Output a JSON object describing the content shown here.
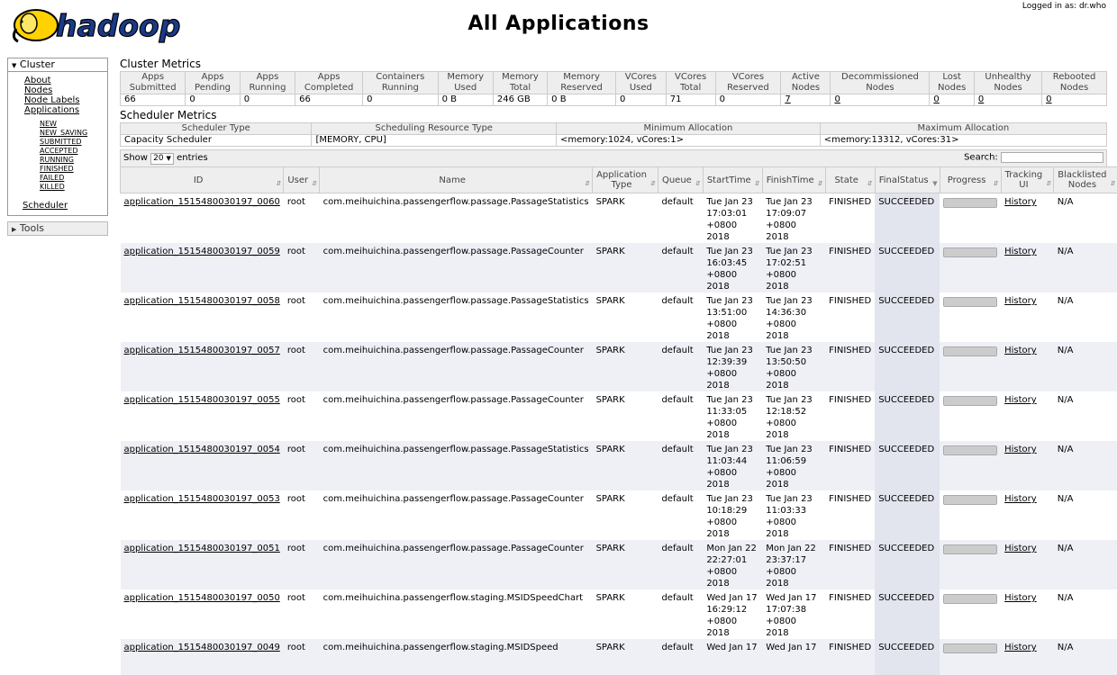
{
  "header": {
    "logo_text": "hadoop",
    "title": "All Applications",
    "login": "Logged in as: dr.who"
  },
  "sidebar": {
    "cluster_label": "Cluster",
    "cluster_items": [
      "About",
      "Node Labels",
      "Applications"
    ],
    "nodes_label": "Nodes",
    "app_states": [
      "NEW",
      "NEW_SAVING",
      "SUBMITTED",
      "ACCEPTED",
      "RUNNING",
      "FINISHED",
      "FAILED",
      "KILLED"
    ],
    "scheduler_label": "Scheduler",
    "tools_label": "Tools"
  },
  "cluster_metrics": {
    "heading": "Cluster Metrics",
    "headers": [
      "Apps Submitted",
      "Apps Pending",
      "Apps Running",
      "Apps Completed",
      "Containers Running",
      "Memory Used",
      "Memory Total",
      "Memory Reserved",
      "VCores Used",
      "VCores Total",
      "VCores Reserved",
      "Active Nodes",
      "Decommissioned Nodes",
      "Lost Nodes",
      "Unhealthy Nodes",
      "Rebooted Nodes"
    ],
    "values": [
      "66",
      "0",
      "0",
      "66",
      "0",
      "0 B",
      "246 GB",
      "0 B",
      "0",
      "71",
      "0",
      "7",
      "0",
      "0",
      "0",
      "0"
    ]
  },
  "scheduler_metrics": {
    "heading": "Scheduler Metrics",
    "headers": [
      "Scheduler Type",
      "Scheduling Resource Type",
      "Minimum Allocation",
      "Maximum Allocation"
    ],
    "values": [
      "Capacity Scheduler",
      "[MEMORY, CPU]",
      "<memory:1024, vCores:1>",
      "<memory:13312, vCores:31>"
    ]
  },
  "table_controls": {
    "show_label": "Show",
    "page_size": "20",
    "entries_label": "entries",
    "search_label": "Search:"
  },
  "apps": {
    "headers": [
      "ID",
      "User",
      "Name",
      "Application Type",
      "Queue",
      "StartTime",
      "FinishTime",
      "State",
      "FinalStatus",
      "Progress",
      "Tracking UI",
      "Blacklisted Nodes"
    ],
    "rows": [
      {
        "id": "application_1515480030197_0060",
        "user": "root",
        "name": "com.meihuichina.passengerflow.passage.PassageStatistics",
        "type": "SPARK",
        "queue": "default",
        "start": "Tue Jan 23 17:03:01 +0800 2018",
        "finish": "Tue Jan 23 17:09:07 +0800 2018",
        "state": "FINISHED",
        "final": "SUCCEEDED",
        "progress": 1.0,
        "tracking": "History",
        "blacklisted": "N/A"
      },
      {
        "id": "application_1515480030197_0059",
        "user": "root",
        "name": "com.meihuichina.passengerflow.passage.PassageCounter",
        "type": "SPARK",
        "queue": "default",
        "start": "Tue Jan 23 16:03:45 +0800 2018",
        "finish": "Tue Jan 23 17:02:51 +0800 2018",
        "state": "FINISHED",
        "final": "SUCCEEDED",
        "progress": 1.0,
        "tracking": "History",
        "blacklisted": "N/A"
      },
      {
        "id": "application_1515480030197_0058",
        "user": "root",
        "name": "com.meihuichina.passengerflow.passage.PassageStatistics",
        "type": "SPARK",
        "queue": "default",
        "start": "Tue Jan 23 13:51:00 +0800 2018",
        "finish": "Tue Jan 23 14:36:30 +0800 2018",
        "state": "FINISHED",
        "final": "SUCCEEDED",
        "progress": 1.0,
        "tracking": "History",
        "blacklisted": "N/A"
      },
      {
        "id": "application_1515480030197_0057",
        "user": "root",
        "name": "com.meihuichina.passengerflow.passage.PassageCounter",
        "type": "SPARK",
        "queue": "default",
        "start": "Tue Jan 23 12:39:39 +0800 2018",
        "finish": "Tue Jan 23 13:50:50 +0800 2018",
        "state": "FINISHED",
        "final": "SUCCEEDED",
        "progress": 1.0,
        "tracking": "History",
        "blacklisted": "N/A"
      },
      {
        "id": "application_1515480030197_0055",
        "user": "root",
        "name": "com.meihuichina.passengerflow.passage.PassageCounter",
        "type": "SPARK",
        "queue": "default",
        "start": "Tue Jan 23 11:33:05 +0800 2018",
        "finish": "Tue Jan 23 12:18:52 +0800 2018",
        "state": "FINISHED",
        "final": "SUCCEEDED",
        "progress": 1.0,
        "tracking": "History",
        "blacklisted": "N/A"
      },
      {
        "id": "application_1515480030197_0054",
        "user": "root",
        "name": "com.meihuichina.passengerflow.passage.PassageStatistics",
        "type": "SPARK",
        "queue": "default",
        "start": "Tue Jan 23 11:03:44 +0800 2018",
        "finish": "Tue Jan 23 11:06:59 +0800 2018",
        "state": "FINISHED",
        "final": "SUCCEEDED",
        "progress": 1.0,
        "tracking": "History",
        "blacklisted": "N/A"
      },
      {
        "id": "application_1515480030197_0053",
        "user": "root",
        "name": "com.meihuichina.passengerflow.passage.PassageCounter",
        "type": "SPARK",
        "queue": "default",
        "start": "Tue Jan 23 10:18:29 +0800 2018",
        "finish": "Tue Jan 23 11:03:33 +0800 2018",
        "state": "FINISHED",
        "final": "SUCCEEDED",
        "progress": 1.0,
        "tracking": "History",
        "blacklisted": "N/A"
      },
      {
        "id": "application_1515480030197_0051",
        "user": "root",
        "name": "com.meihuichina.passengerflow.passage.PassageCounter",
        "type": "SPARK",
        "queue": "default",
        "start": "Mon Jan 22 22:27:01 +0800 2018",
        "finish": "Mon Jan 22 23:37:17 +0800 2018",
        "state": "FINISHED",
        "final": "SUCCEEDED",
        "progress": 1.0,
        "tracking": "History",
        "blacklisted": "N/A"
      },
      {
        "id": "application_1515480030197_0050",
        "user": "root",
        "name": "com.meihuichina.passengerflow.staging.MSIDSpeedChart",
        "type": "SPARK",
        "queue": "default",
        "start": "Wed Jan 17 16:29:12 +0800 2018",
        "finish": "Wed Jan 17 17:07:38 +0800 2018",
        "state": "FINISHED",
        "final": "SUCCEEDED",
        "progress": 1.0,
        "tracking": "History",
        "blacklisted": "N/A"
      },
      {
        "id": "application_1515480030197_0049",
        "user": "root",
        "name": "com.meihuichina.passengerflow.staging.MSIDSpeed",
        "type": "SPARK",
        "queue": "default",
        "start": "Wed Jan 17",
        "finish": "Wed Jan 17",
        "state": "FINISHED",
        "final": "SUCCEEDED",
        "progress": 1.0,
        "tracking": "History",
        "blacklisted": "N/A"
      }
    ]
  },
  "colors": {
    "header_bg": "#eeeeee",
    "row_alt": "#eef0f6",
    "sorted_column": "#e2e4ee",
    "logo_yellow": "#ffd200"
  }
}
